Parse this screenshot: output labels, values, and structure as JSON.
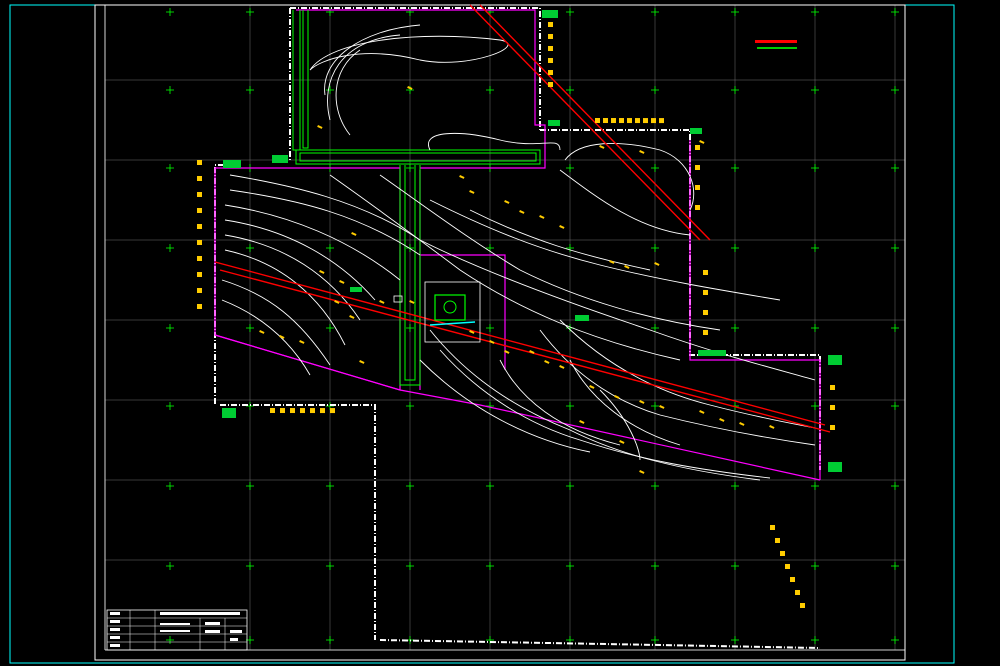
{
  "drawing": {
    "background": "#000000",
    "colors": {
      "frame": "#ffffff",
      "border_cyan": "#00ffff",
      "grid": "#ffffff",
      "grid_marker": "#00ff00",
      "contour": "#ffffff",
      "boundary": "#ff00ff",
      "road_red": "#ff0000",
      "channel_green": "#00ff00",
      "annotation_yellow": "#ffcc00",
      "legend_red": "#ff0000"
    },
    "annotations": {
      "north_road": "",
      "east_road": "",
      "west_road": "",
      "south_road": "",
      "mid_road": "",
      "southeast_road": ""
    },
    "legend": {
      "line1": "",
      "line2": ""
    },
    "title_block": {
      "rows": [
        "",
        "",
        "",
        "",
        ""
      ],
      "project": "",
      "drawing_name": "",
      "scale": "",
      "number": ""
    }
  }
}
